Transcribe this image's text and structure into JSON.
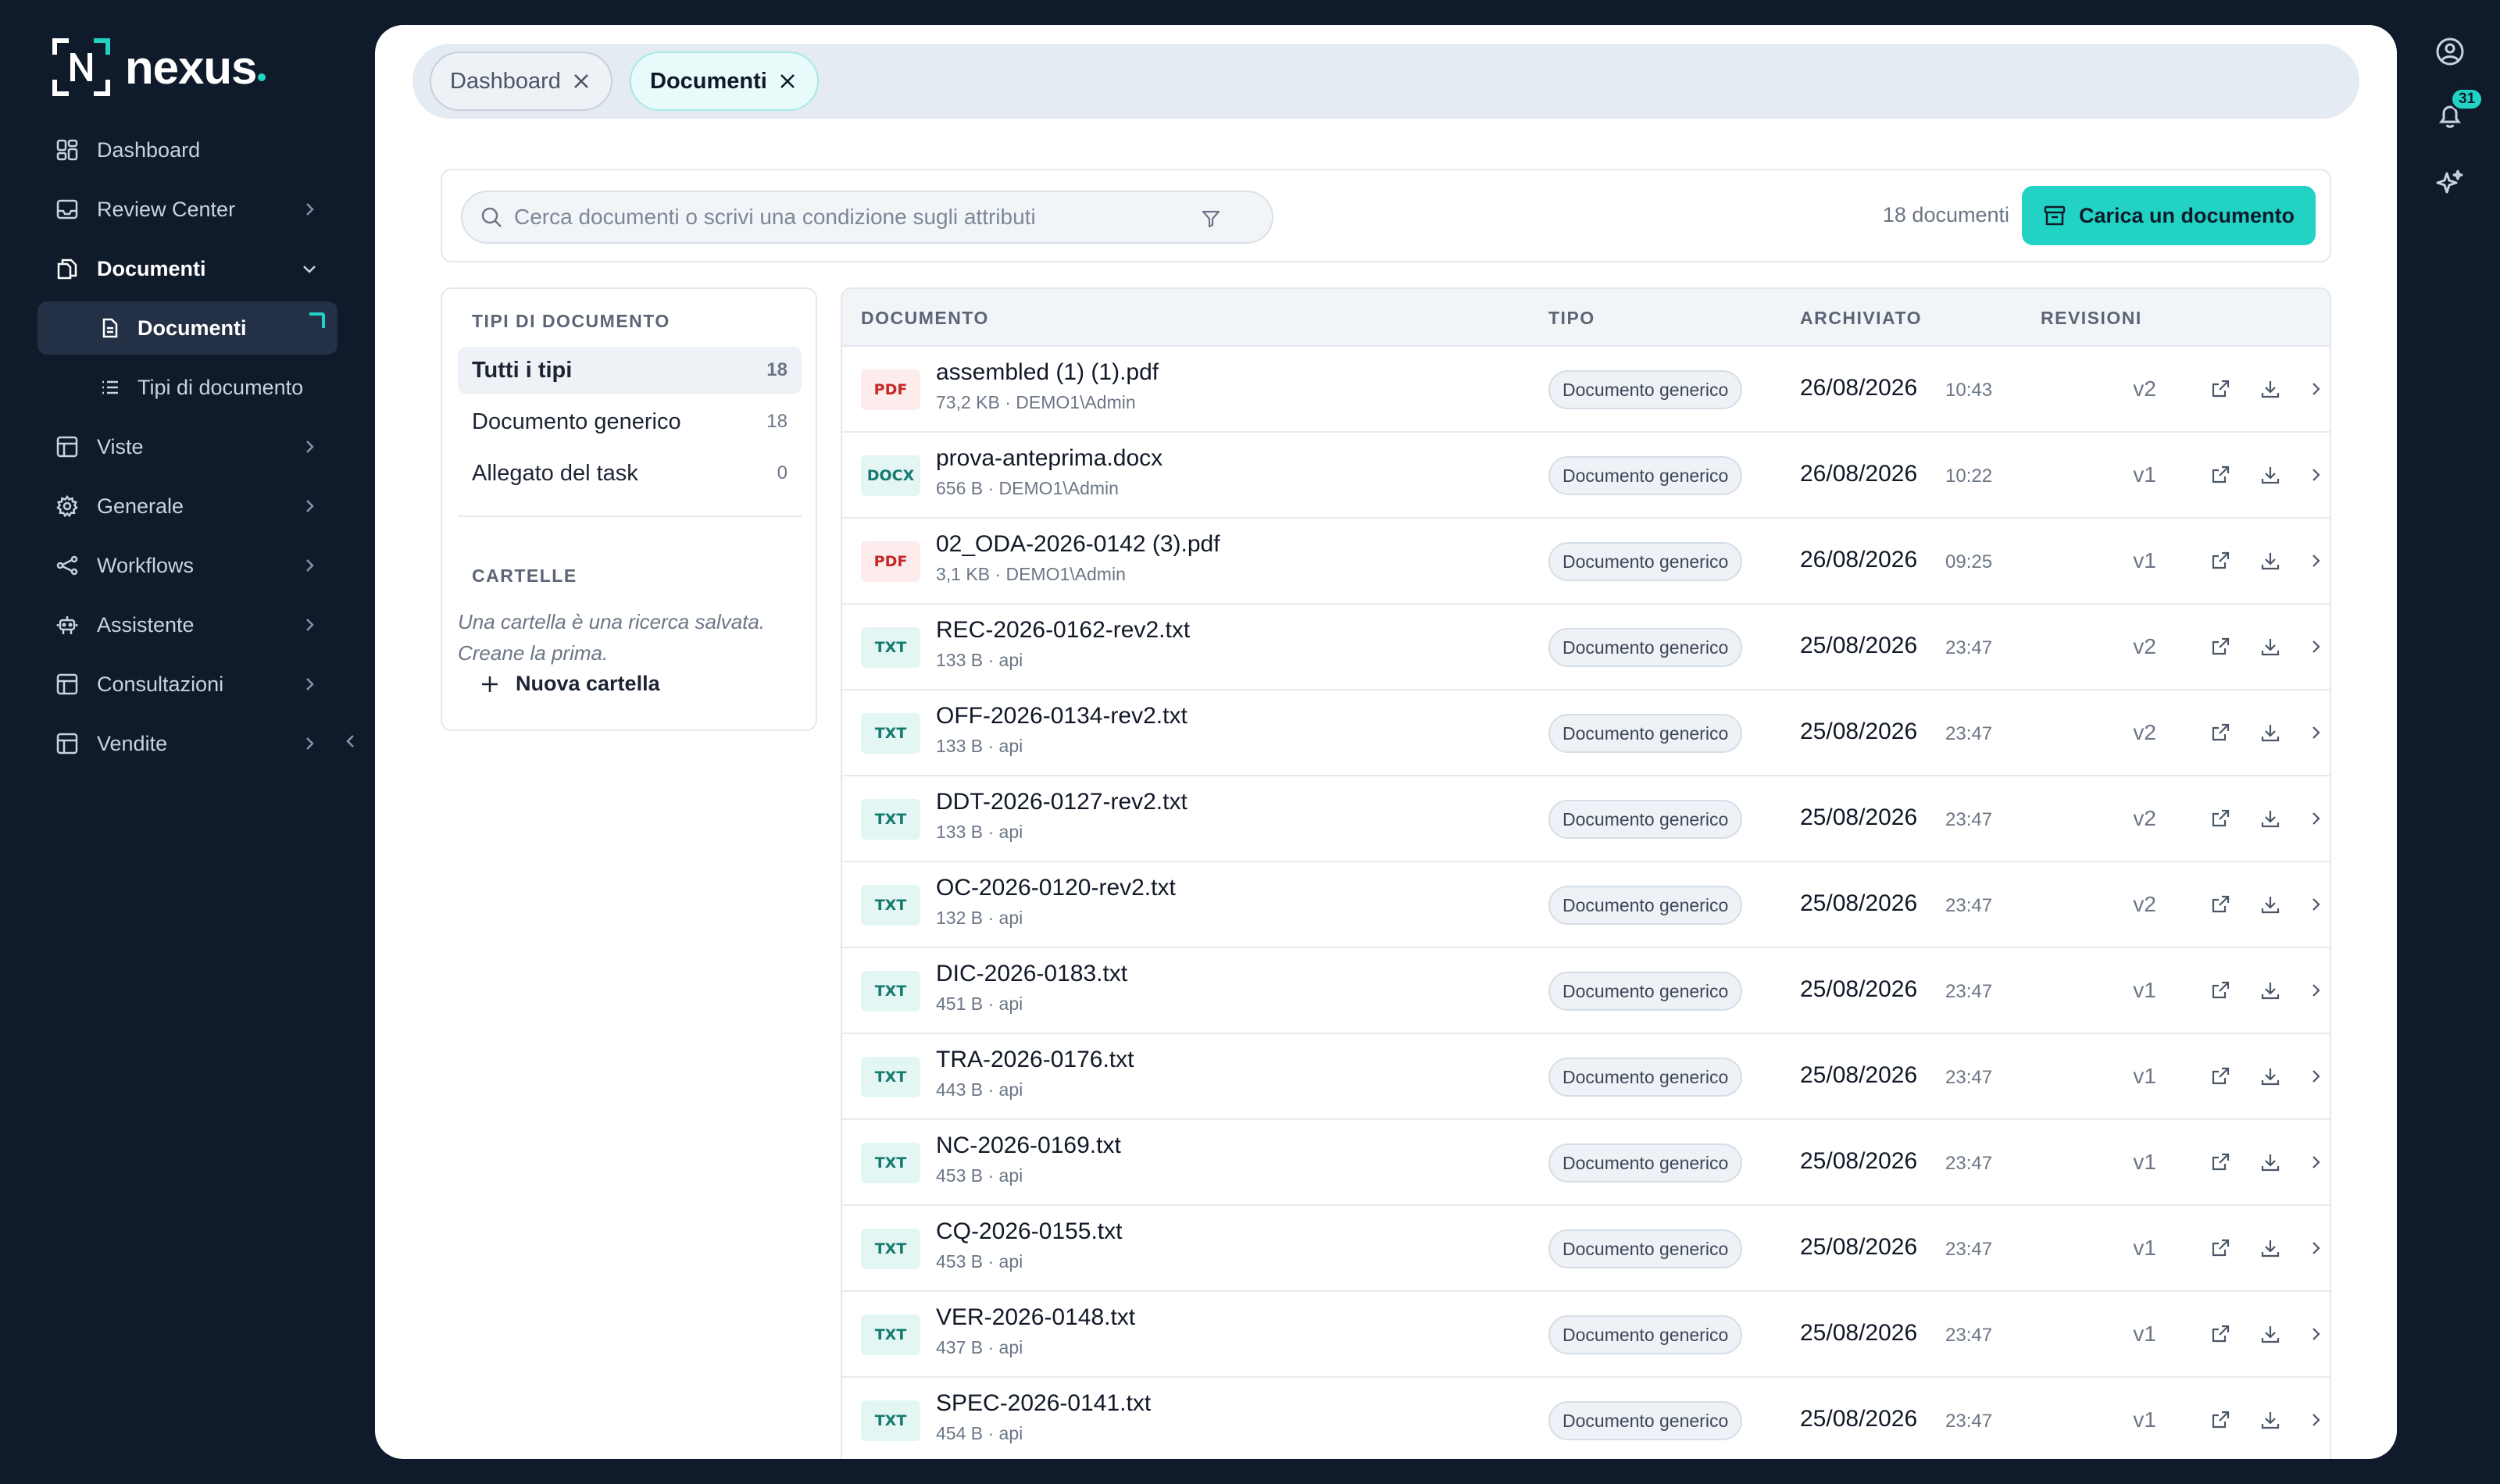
{
  "brand": {
    "name": "nexus",
    "accent": "#22d3c5"
  },
  "sidebar": {
    "items": [
      {
        "label": "Dashboard",
        "icon": "dashboard-grid-icon",
        "chevron": false
      },
      {
        "label": "Review Center",
        "icon": "inbox-icon",
        "chevron": true
      },
      {
        "label": "Documenti",
        "icon": "documents-icon",
        "chevron": true,
        "expanded": true
      },
      {
        "label": "Viste",
        "icon": "table-icon",
        "chevron": true
      },
      {
        "label": "Generale",
        "icon": "gear-icon",
        "chevron": true
      },
      {
        "label": "Workflows",
        "icon": "workflow-icon",
        "chevron": true
      },
      {
        "label": "Assistente",
        "icon": "robot-icon",
        "chevron": true
      },
      {
        "label": "Consultazioni",
        "icon": "table-icon",
        "chevron": true
      },
      {
        "label": "Vendite",
        "icon": "table-icon",
        "chevron": true
      }
    ],
    "sub_items": [
      {
        "label": "Documenti",
        "icon": "file-icon",
        "active": true
      },
      {
        "label": "Tipi di documento",
        "icon": "list-icon",
        "active": false
      }
    ]
  },
  "tabs": [
    {
      "label": "Dashboard",
      "active": false
    },
    {
      "label": "Documenti",
      "active": true
    }
  ],
  "rail": {
    "notifications_count": "31"
  },
  "toolbar": {
    "search_placeholder": "Cerca documenti o scrivi una condizione sugli attributi",
    "doc_count": "18 documenti",
    "upload_label": "Carica un documento"
  },
  "filters": {
    "types_title": "TIPI DI DOCUMENTO",
    "types": [
      {
        "label": "Tutti i tipi",
        "count": "18",
        "selected": true
      },
      {
        "label": "Documento generico",
        "count": "18",
        "selected": false
      },
      {
        "label": "Allegato del task",
        "count": "0",
        "selected": false
      }
    ],
    "folders_title": "CARTELLE",
    "folders_hint": "Una cartella è una ricerca salvata. Creane la prima.",
    "new_folder_label": "Nuova cartella"
  },
  "table": {
    "headers": {
      "document": "DOCUMENTO",
      "type": "TIPO",
      "archived": "ARCHIVIATO",
      "revisions": "REVISIONI"
    },
    "rows": [
      {
        "ext": "PDF",
        "kind": "pdf",
        "name": "assembled (1) (1).pdf",
        "meta": "73,2 KB · DEMO1\\Admin",
        "type": "Documento generico",
        "date": "26/08/2026",
        "time": "10:43",
        "rev": "v2"
      },
      {
        "ext": "DOCX",
        "kind": "docx",
        "name": "prova-anteprima.docx",
        "meta": "656 B · DEMO1\\Admin",
        "type": "Documento generico",
        "date": "26/08/2026",
        "time": "10:22",
        "rev": "v1"
      },
      {
        "ext": "PDF",
        "kind": "pdf",
        "name": "02_ODA-2026-0142 (3).pdf",
        "meta": "3,1 KB · DEMO1\\Admin",
        "type": "Documento generico",
        "date": "26/08/2026",
        "time": "09:25",
        "rev": "v1"
      },
      {
        "ext": "TXT",
        "kind": "txt",
        "name": "REC-2026-0162-rev2.txt",
        "meta": "133 B · api",
        "type": "Documento generico",
        "date": "25/08/2026",
        "time": "23:47",
        "rev": "v2"
      },
      {
        "ext": "TXT",
        "kind": "txt",
        "name": "OFF-2026-0134-rev2.txt",
        "meta": "133 B · api",
        "type": "Documento generico",
        "date": "25/08/2026",
        "time": "23:47",
        "rev": "v2"
      },
      {
        "ext": "TXT",
        "kind": "txt",
        "name": "DDT-2026-0127-rev2.txt",
        "meta": "133 B · api",
        "type": "Documento generico",
        "date": "25/08/2026",
        "time": "23:47",
        "rev": "v2"
      },
      {
        "ext": "TXT",
        "kind": "txt",
        "name": "OC-2026-0120-rev2.txt",
        "meta": "132 B · api",
        "type": "Documento generico",
        "date": "25/08/2026",
        "time": "23:47",
        "rev": "v2"
      },
      {
        "ext": "TXT",
        "kind": "txt",
        "name": "DIC-2026-0183.txt",
        "meta": "451 B · api",
        "type": "Documento generico",
        "date": "25/08/2026",
        "time": "23:47",
        "rev": "v1"
      },
      {
        "ext": "TXT",
        "kind": "txt",
        "name": "TRA-2026-0176.txt",
        "meta": "443 B · api",
        "type": "Documento generico",
        "date": "25/08/2026",
        "time": "23:47",
        "rev": "v1"
      },
      {
        "ext": "TXT",
        "kind": "txt",
        "name": "NC-2026-0169.txt",
        "meta": "453 B · api",
        "type": "Documento generico",
        "date": "25/08/2026",
        "time": "23:47",
        "rev": "v1"
      },
      {
        "ext": "TXT",
        "kind": "txt",
        "name": "CQ-2026-0155.txt",
        "meta": "453 B · api",
        "type": "Documento generico",
        "date": "25/08/2026",
        "time": "23:47",
        "rev": "v1"
      },
      {
        "ext": "TXT",
        "kind": "txt",
        "name": "VER-2026-0148.txt",
        "meta": "437 B · api",
        "type": "Documento generico",
        "date": "25/08/2026",
        "time": "23:47",
        "rev": "v1"
      },
      {
        "ext": "TXT",
        "kind": "txt",
        "name": "SPEC-2026-0141.txt",
        "meta": "454 B · api",
        "type": "Documento generico",
        "date": "25/08/2026",
        "time": "23:47",
        "rev": "v1"
      }
    ],
    "row_actions": [
      "open-external-icon",
      "download-icon",
      "chevron-right-icon"
    ]
  }
}
